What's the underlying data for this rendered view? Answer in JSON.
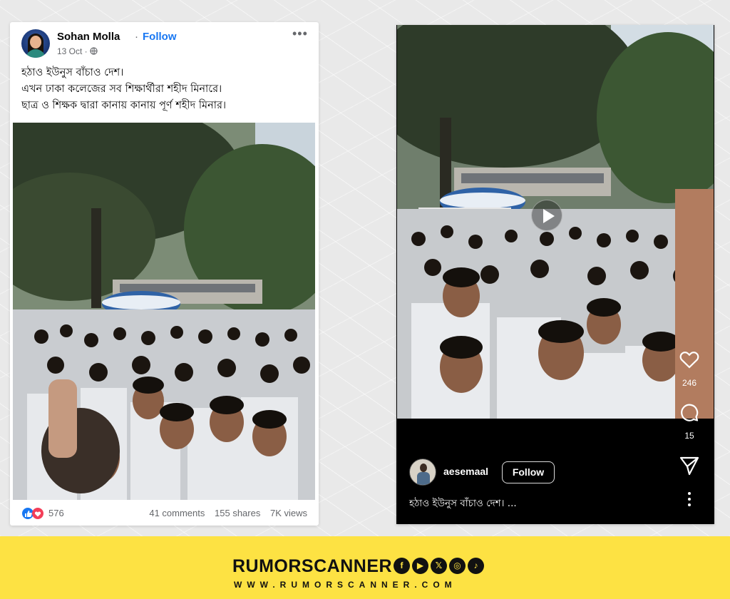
{
  "facebook_post": {
    "author": "Sohan Molla",
    "separator": "·",
    "follow_label": "Follow",
    "date": "13 Oct ·",
    "more_label": "•••",
    "text_lines": [
      "হঠাও ইউনুস বাঁচাও দেশ।",
      "এখন ঢাকা কলেজের সব শিক্ষার্থীরা শহীদ মিনারে।",
      "ছাত্র ও শিক্ষক দ্বারা  কানায় কানায় পূর্ণ শহীদ মিনার।"
    ],
    "reaction_count": "576",
    "comments": "41 comments",
    "shares": "155 shares",
    "views": "7K views",
    "icons": [
      "globe-icon",
      "like-icon",
      "love-icon",
      "volume-icon",
      "more-icon"
    ]
  },
  "instagram_post": {
    "username": "aesemaal",
    "follow_label": "Follow",
    "caption": "হঠাও ইউনুস বাঁচাও দেশ। ...",
    "likes": "246",
    "comments": "15",
    "icons": [
      "play-icon",
      "heart-icon",
      "comment-icon",
      "share-icon",
      "more-vertical-icon"
    ]
  },
  "brand": {
    "name": "RUMORSCANNER",
    "url": "WWW.RUMORSCANNER.COM",
    "socials": [
      "f",
      "▶",
      "𝕏",
      "◎",
      "♪"
    ],
    "background_color": "#fde243"
  }
}
